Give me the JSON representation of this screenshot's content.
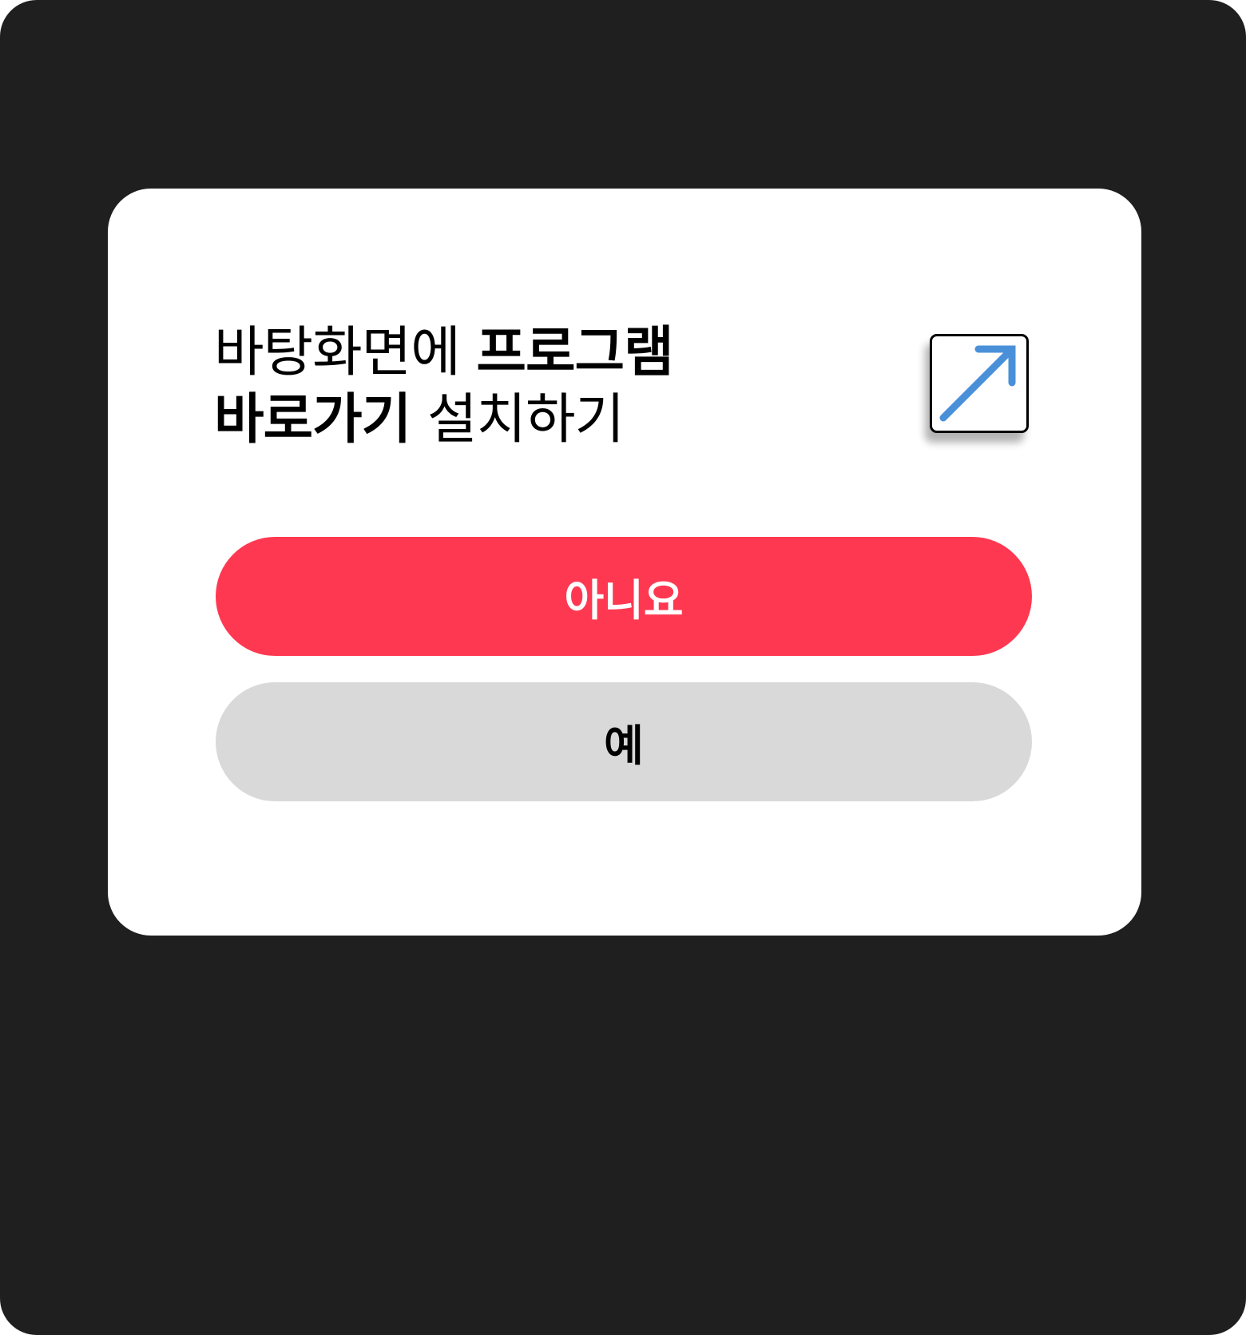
{
  "dialog": {
    "title_line1_normal": "바탕화면에 ",
    "title_line1_bold": "프로그램",
    "title_line2_bold": "바로가기",
    "title_line2_normal": " 설치하기",
    "icon": "shortcut-arrow-icon"
  },
  "buttons": {
    "no_label": "아니요",
    "yes_label": "예"
  },
  "colors": {
    "background": "#1f1f1f",
    "dialog": "#ffffff",
    "no_button": "#ff3851",
    "yes_button": "#d9d9d9",
    "arrow": "#4a90d9"
  }
}
